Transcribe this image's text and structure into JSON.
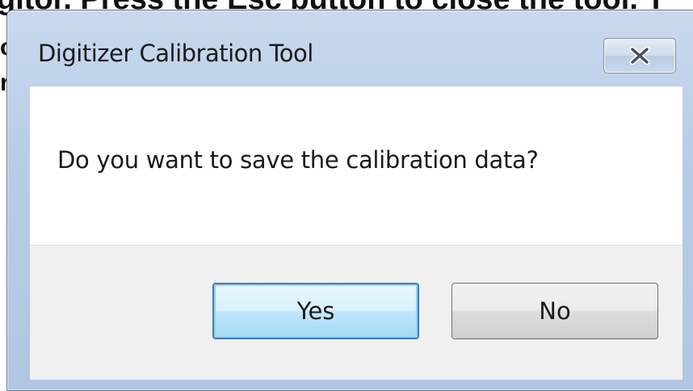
{
  "background": {
    "text": "gitor. Press the Esc button to close the tool. T",
    "fragment_1": "c",
    "fragment_2": "r"
  },
  "dialog": {
    "title": "Digitizer Calibration Tool",
    "close_icon": "close-x-icon",
    "message": "Do you want to save the calibration data?",
    "buttons": {
      "yes_label": "Yes",
      "no_label": "No"
    }
  }
}
